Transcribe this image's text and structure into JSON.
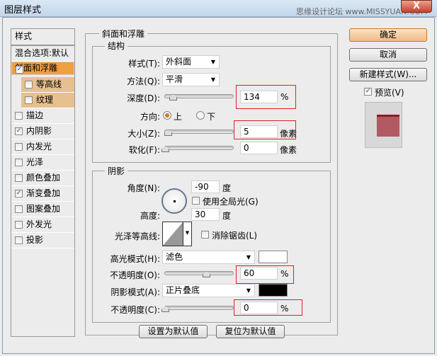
{
  "window": {
    "title": "图层样式",
    "watermark": "思缘设计论坛 www.MISSYUAN.COM",
    "close": "X"
  },
  "sidebar": {
    "header": "样式",
    "blend": "混合选项:默认",
    "items": [
      {
        "label": "斜面和浮雕",
        "checked": true
      },
      {
        "label": "等高线",
        "checked": false
      },
      {
        "label": "纹理",
        "checked": false
      },
      {
        "label": "描边",
        "checked": false
      },
      {
        "label": "内阴影",
        "checked": true
      },
      {
        "label": "内发光",
        "checked": false
      },
      {
        "label": "光泽",
        "checked": false
      },
      {
        "label": "颜色叠加",
        "checked": false
      },
      {
        "label": "渐变叠加",
        "checked": true
      },
      {
        "label": "图案叠加",
        "checked": false
      },
      {
        "label": "外发光",
        "checked": false
      },
      {
        "label": "投影",
        "checked": false
      }
    ]
  },
  "bevel": {
    "title": "斜面和浮雕",
    "structure": "结构",
    "style_label": "样式(T):",
    "style_value": "外斜面",
    "method_label": "方法(Q):",
    "method_value": "平滑",
    "depth_label": "深度(D):",
    "depth_value": "134",
    "depth_unit": "%",
    "depth_fraction": 0.134,
    "direction_label": "方向:",
    "dir_up": "上",
    "dir_down": "下",
    "direction_selected": "上",
    "size_label": "大小(Z):",
    "size_value": "5",
    "size_unit": "像素",
    "soften_label": "软化(F):",
    "soften_value": "0",
    "soften_unit": "像素"
  },
  "shading": {
    "title": "阴影",
    "angle_label": "角度(N):",
    "angle_value": "-90",
    "angle_unit": "度",
    "global_light": "使用全局光(G)",
    "altitude_label": "高度:",
    "altitude_value": "30",
    "altitude_unit": "度",
    "gloss_label": "光泽等高线:",
    "antialias": "消除锯齿(L)",
    "highlight_label": "高光模式(H):",
    "highlight_value": "滤色",
    "highlight_color": "#ffffff",
    "hl_opacity_label": "不透明度(O):",
    "hl_opacity_value": "60",
    "hl_opacity_unit": "%",
    "shadow_label": "阴影模式(A):",
    "shadow_value": "正片叠底",
    "shadow_color": "#000000",
    "sh_opacity_label": "不透明度(C):",
    "sh_opacity_value": "0",
    "sh_opacity_unit": "%"
  },
  "buttons": {
    "ok": "确定",
    "cancel": "取消",
    "new_style": "新建样式(W)...",
    "preview": "预览(V)",
    "set_default": "设置为默认值",
    "reset_default": "复位为默认值"
  }
}
